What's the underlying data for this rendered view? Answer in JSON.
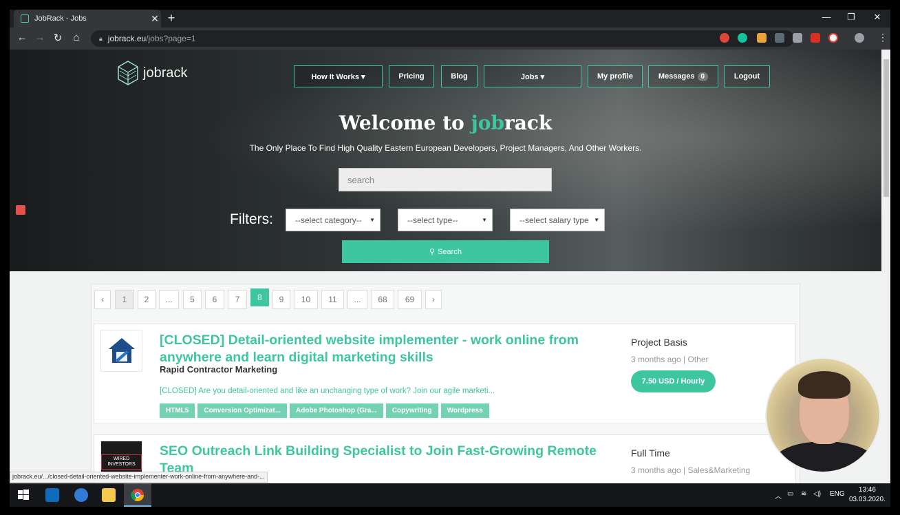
{
  "browser": {
    "tab_title": "JobRack - Jobs",
    "tab_close": "✕",
    "new_tab": "+",
    "url_host": "jobrack.eu",
    "url_path": "/jobs?page=1",
    "status_url": "jobrack.eu/.../closed-detail-oriented-website-implementer-work-online-from-anywhere-and-..."
  },
  "site": {
    "logo_text": "jobrack",
    "accent_color": "#3ec6a0"
  },
  "nav": {
    "how_it_works": "How It Works ▾",
    "pricing": "Pricing",
    "blog": "Blog",
    "jobs": "Jobs ▾",
    "my_profile": "My profile",
    "messages": "Messages",
    "messages_count": "0",
    "logout": "Logout"
  },
  "hero": {
    "title_pre": "Welcome to ",
    "title_accent": "job",
    "title_post": "rack",
    "subtitle": "The Only Place To Find High Quality Eastern European Developers, Project Managers, And Other Workers.",
    "search_placeholder": "search",
    "filters_label": "Filters:",
    "select_category": "--select category--",
    "select_type": "--select type--",
    "select_salary": "--select salary type",
    "search_button": "Search"
  },
  "pagination": [
    "‹",
    "1",
    "2",
    "...",
    "5",
    "6",
    "7",
    "8",
    "9",
    "10",
    "11",
    "...",
    "68",
    "69",
    "›"
  ],
  "pagination_active": "8",
  "jobs": [
    {
      "title": "[CLOSED] Detail-oriented website implementer - work online from anywhere and learn digital marketing skills",
      "company": "Rapid Contractor Marketing",
      "snippet": "[CLOSED] Are you detail-oriented and like an unchanging type of work? Join our agile marketi...",
      "tags": [
        "HTML5",
        "Conversion Optimizat...",
        "Adobe Photoshop (Gra...",
        "Copywriting",
        "Wordpress"
      ],
      "type": "Project Basis",
      "meta": "3 months ago | Other",
      "rate": "7.50 USD / Hourly"
    },
    {
      "title": "SEO Outreach Link Building Specialist to Join Fast-Growing Remote Team",
      "company": "",
      "logo_text": "WIRED INVESTORS",
      "type": "Full Time",
      "meta": "3 months ago | Sales&Marketing"
    }
  ],
  "taskbar": {
    "language": "ENG",
    "time": "13:46",
    "date": "03.03.2020."
  }
}
